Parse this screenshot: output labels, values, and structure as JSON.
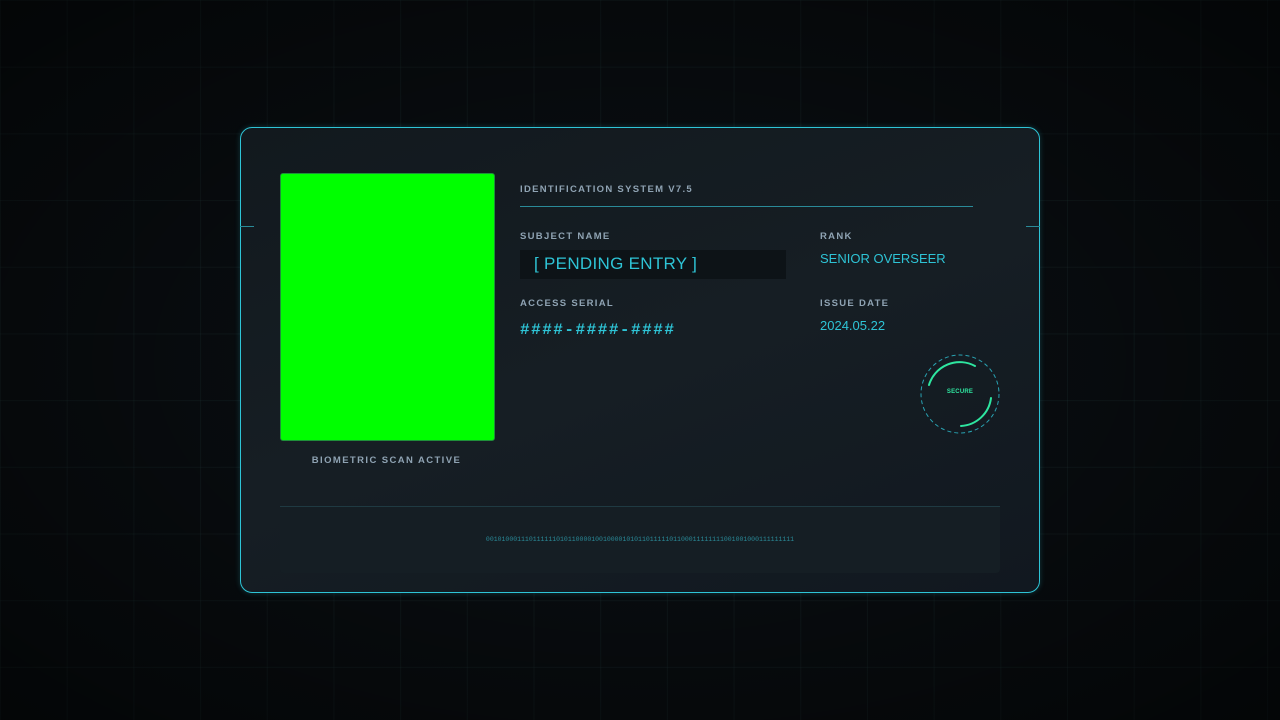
{
  "card": {
    "system_title": "IDENTIFICATION SYSTEM V7.5",
    "photo_caption": "BIOMETRIC SCAN ACTIVE",
    "subject_name_label": "SUBJECT NAME",
    "subject_name_value": "[ PENDING ENTRY ]",
    "rank_label": "RANK",
    "rank_value": "SENIOR OVERSEER",
    "access_serial_label": "ACCESS SERIAL",
    "access_serial_value": "####-####-####",
    "issue_date_label": "ISSUE DATE",
    "issue_date_value": "2024.05.22",
    "seal_text": "SECURE",
    "binary_strip": "0010100011101111110101100001001000010101101111101100011111111001001000111111111"
  },
  "colors": {
    "accent": "#2ec4d6",
    "seal_green": "#2ee6a0",
    "photo_placeholder": "#00ff00",
    "label_gray": "#8fa3b3",
    "background": "#080c0f"
  }
}
